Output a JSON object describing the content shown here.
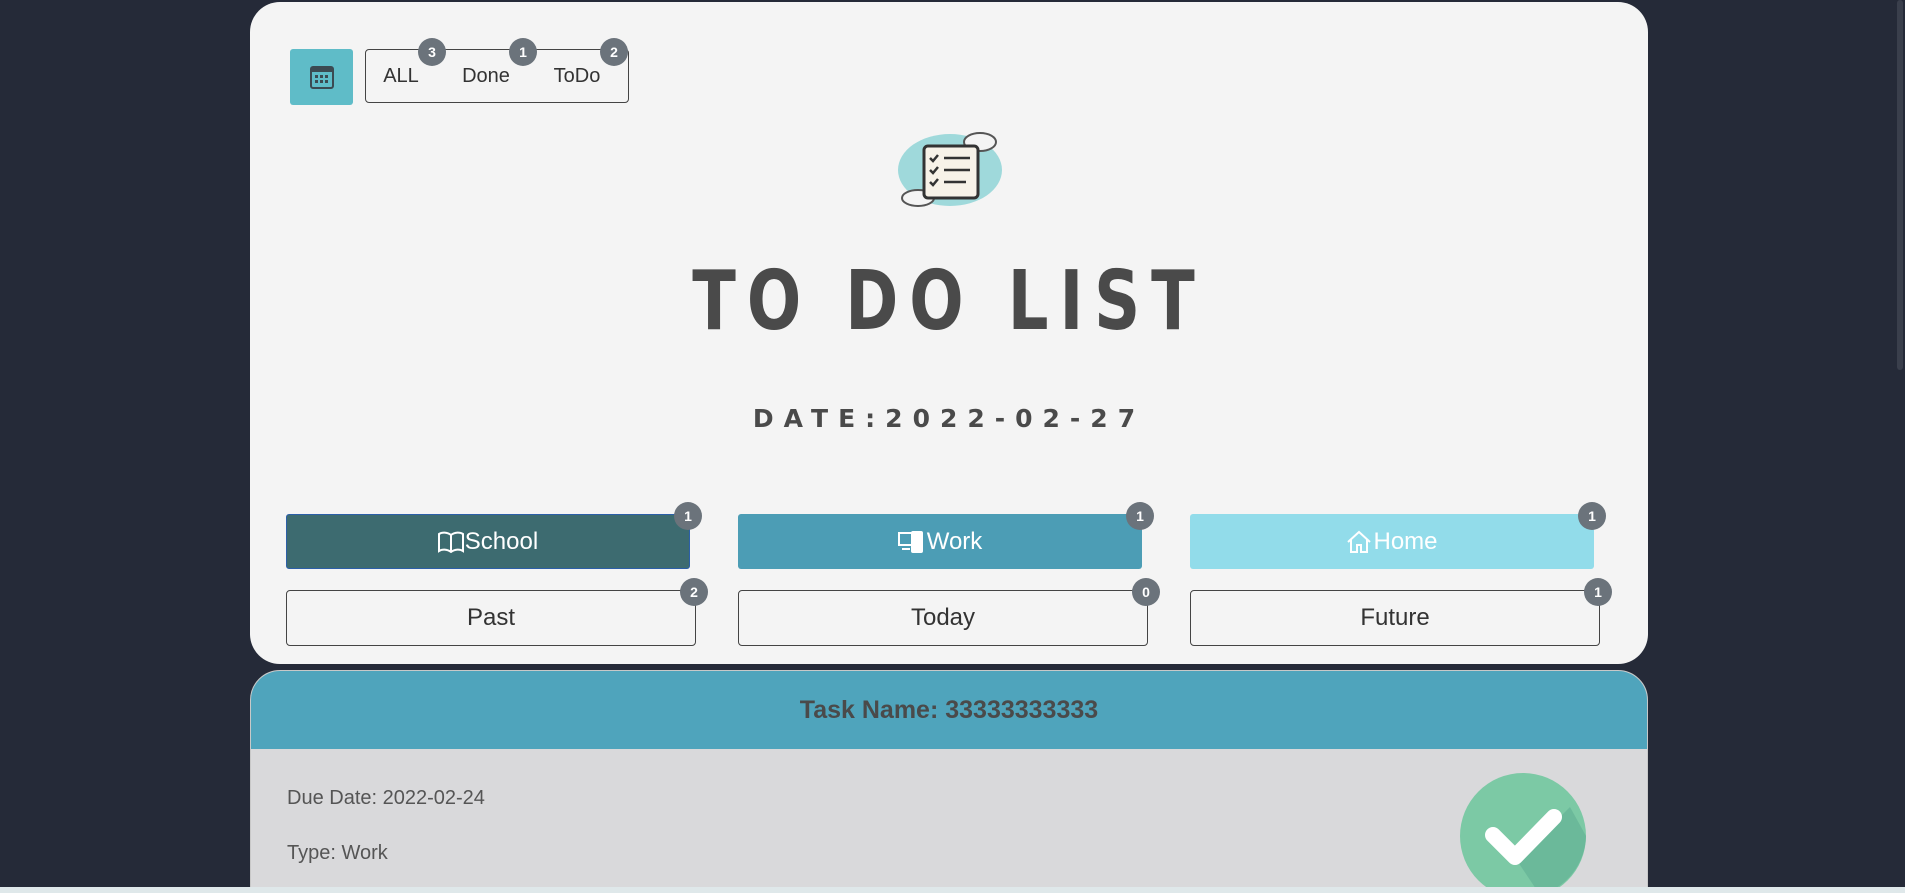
{
  "filters": {
    "items": [
      {
        "label": "ALL",
        "count": "3"
      },
      {
        "label": "Done",
        "count": "1"
      },
      {
        "label": "ToDo",
        "count": "2"
      }
    ]
  },
  "header": {
    "title": "TO DO LIST",
    "date": "DATE:2022-02-27"
  },
  "categories": [
    {
      "label": "School",
      "count": "1",
      "icon": "book-icon",
      "color": "#3d6b70"
    },
    {
      "label": "Work",
      "count": "1",
      "icon": "devices-icon",
      "color": "#4c9db5"
    },
    {
      "label": "Home",
      "count": "1",
      "icon": "house-icon",
      "color": "#92dcea"
    }
  ],
  "times": [
    {
      "label": "Past",
      "count": "2"
    },
    {
      "label": "Today",
      "count": "0"
    },
    {
      "label": "Future",
      "count": "1"
    }
  ],
  "task": {
    "name": "Task Name: 33333333333",
    "due": "Due Date: 2022-02-24",
    "type": "Type: Work",
    "status_icon": "check-circle-icon"
  },
  "colors": {
    "background": "#252a38",
    "card": "#f4f4f4",
    "accent": "#5fbcc8",
    "badge": "#6b737b",
    "done": "#7cc9a5"
  }
}
